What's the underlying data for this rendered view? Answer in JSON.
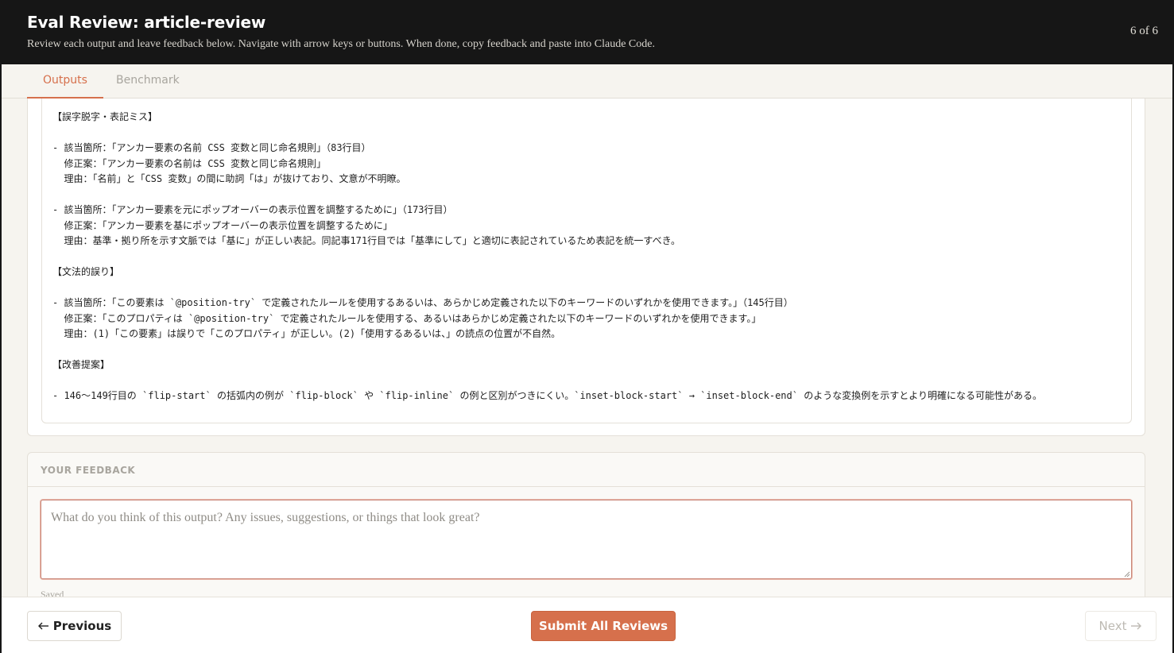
{
  "header": {
    "title": "Eval Review: article-review",
    "subtitle": "Review each output and leave feedback below. Navigate with arrow keys or buttons. When done, copy feedback and paste into Claude Code.",
    "counter": "6 of 6"
  },
  "tabs": [
    {
      "label": "Outputs",
      "active": true
    },
    {
      "label": "Benchmark",
      "active": false
    }
  ],
  "output": {
    "text": "【誤字脱字・表記ミス】\n\n- 該当箇所：「アンカー要素の名前 CSS 変数と同じ命名規則」（83行目）\n  修正案：「アンカー要素の名前は CSS 変数と同じ命名規則」\n  理由：「名前」と「CSS 変数」の間に助詞「は」が抜けており、文意が不明瞭。\n\n- 該当箇所：「アンカー要素を元にポップオーバーの表示位置を調整するために」（173行目）\n  修正案：「アンカー要素を基にポップオーバーの表示位置を調整するために」\n  理由：基準・拠り所を示す文脈では「基に」が正しい表記。同記事171行目では「基準にして」と適切に表記されているため表記を統一すべき。\n\n【文法的誤り】\n\n- 該当箇所：「この要素は `@position-try` で定義されたルールを使用するあるいは、あらかじめ定義された以下のキーワードのいずれかを使用できます。」（145行目）\n  修正案：「このプロパティは `@position-try` で定義されたルールを使用する、あるいはあらかじめ定義された以下のキーワードのいずれかを使用できます。」\n  理由：(1)「この要素」は誤りで「このプロパティ」が正しい。(2)「使用するあるいは、」の読点の位置が不自然。\n\n【改善提案】\n\n- 146〜149行目の `flip-start` の括弧内の例が `flip-block` や `flip-inline` の例と区別がつきにくい。`inset-block-start` → `inset-block-end` のような変換例を示すとより明確になる可能性がある。"
  },
  "feedback": {
    "label": "YOUR FEEDBACK",
    "placeholder": "What do you think of this output? Any issues, suggestions, or things that look great?",
    "value": "",
    "status": "Saved"
  },
  "footer": {
    "prev_label": "Previous",
    "submit_label": "Submit All Reviews",
    "next_label": "Next"
  },
  "colors": {
    "accent": "#d6704c",
    "header_bg": "#161616",
    "page_bg": "#f6f4ef"
  },
  "icons": {
    "prev": "arrow-left-icon",
    "next": "arrow-right-icon"
  }
}
